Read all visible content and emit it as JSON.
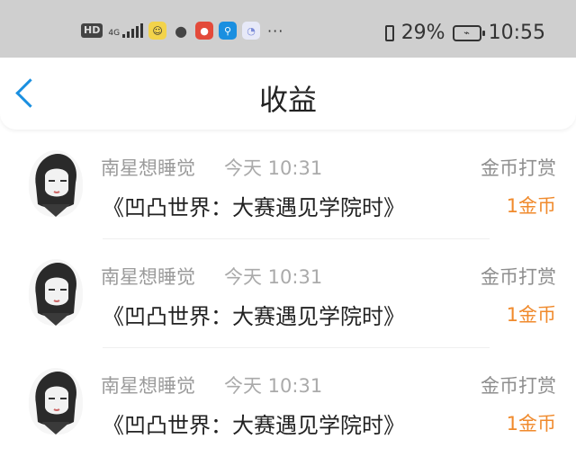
{
  "status": {
    "hd": "HD",
    "network": "4G",
    "battery_percent": "29%",
    "time": "10:55"
  },
  "nav": {
    "title": "收益"
  },
  "records": [
    {
      "name": "南星想睡觉",
      "time": "今天 10:31",
      "type": "金币打赏",
      "book": "《凹凸世界：大赛遇见学院时》",
      "amount": "1金币"
    },
    {
      "name": "南星想睡觉",
      "time": "今天 10:31",
      "type": "金币打赏",
      "book": "《凹凸世界：大赛遇见学院时》",
      "amount": "1金币"
    },
    {
      "name": "南星想睡觉",
      "time": "今天 10:31",
      "type": "金币打赏",
      "book": "《凹凸世界：大赛遇见学院时》",
      "amount": "1金币"
    }
  ]
}
